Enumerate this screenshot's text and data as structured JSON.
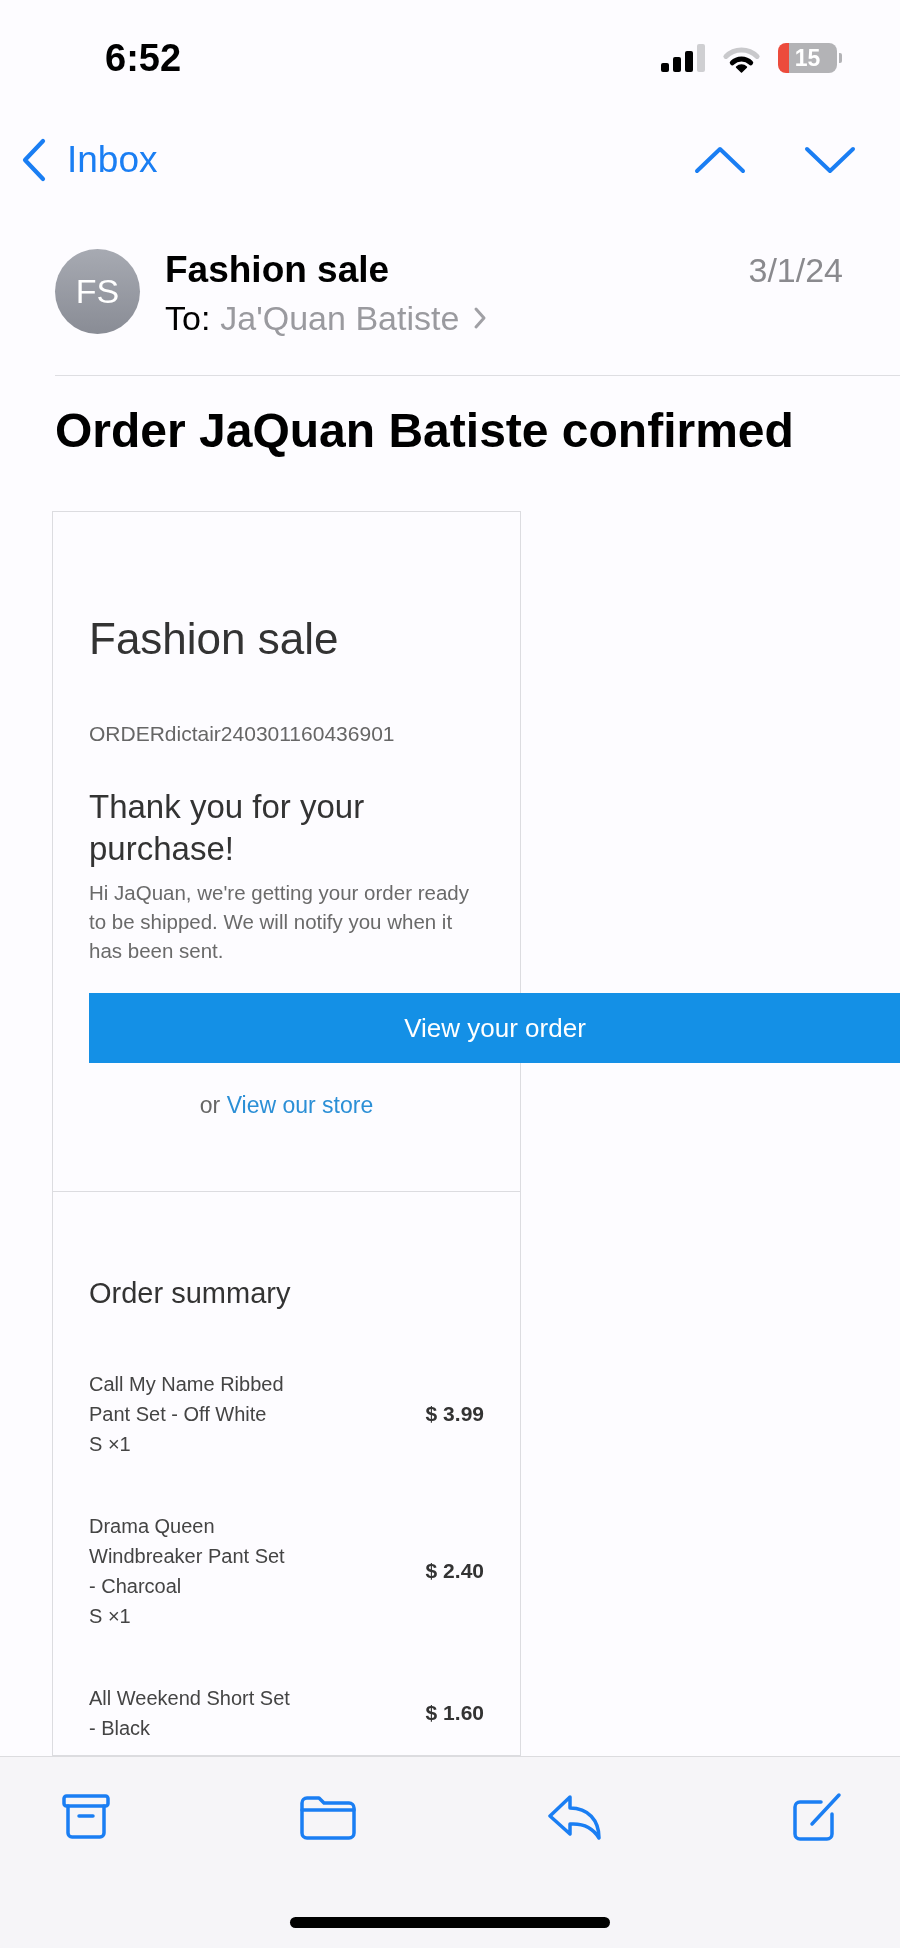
{
  "status_bar": {
    "time": "6:52",
    "battery": "15"
  },
  "nav_bar": {
    "back_label": "Inbox"
  },
  "message": {
    "avatar_initials": "FS",
    "sender": "Fashion sale",
    "date": "3/1/24",
    "to_label": "To:",
    "recipient": "Ja'Quan Batiste",
    "subject": "Order JaQuan Batiste confirmed"
  },
  "order_card": {
    "brand": "Fashion sale",
    "order_number": "ORDERdictair240301160436901",
    "heading": "Thank you for your purchase!",
    "message": "Hi JaQuan, we're getting your order ready to be shipped. We will notify you when it has been sent.",
    "button": "View your order",
    "store_prompt": "or",
    "store_link": "View our store"
  },
  "order_summary": {
    "title": "Order summary",
    "items": [
      {
        "name": "Call My Name Ribbed Pant Set - Off White",
        "variant": "S ×1",
        "price": "$ 3.99"
      },
      {
        "name": "Drama Queen Windbreaker Pant Set - Charcoal",
        "variant": "S ×1",
        "price": "$ 2.40"
      },
      {
        "name": "All Weekend Short Set - Black",
        "price": "$ 1.60"
      }
    ]
  }
}
